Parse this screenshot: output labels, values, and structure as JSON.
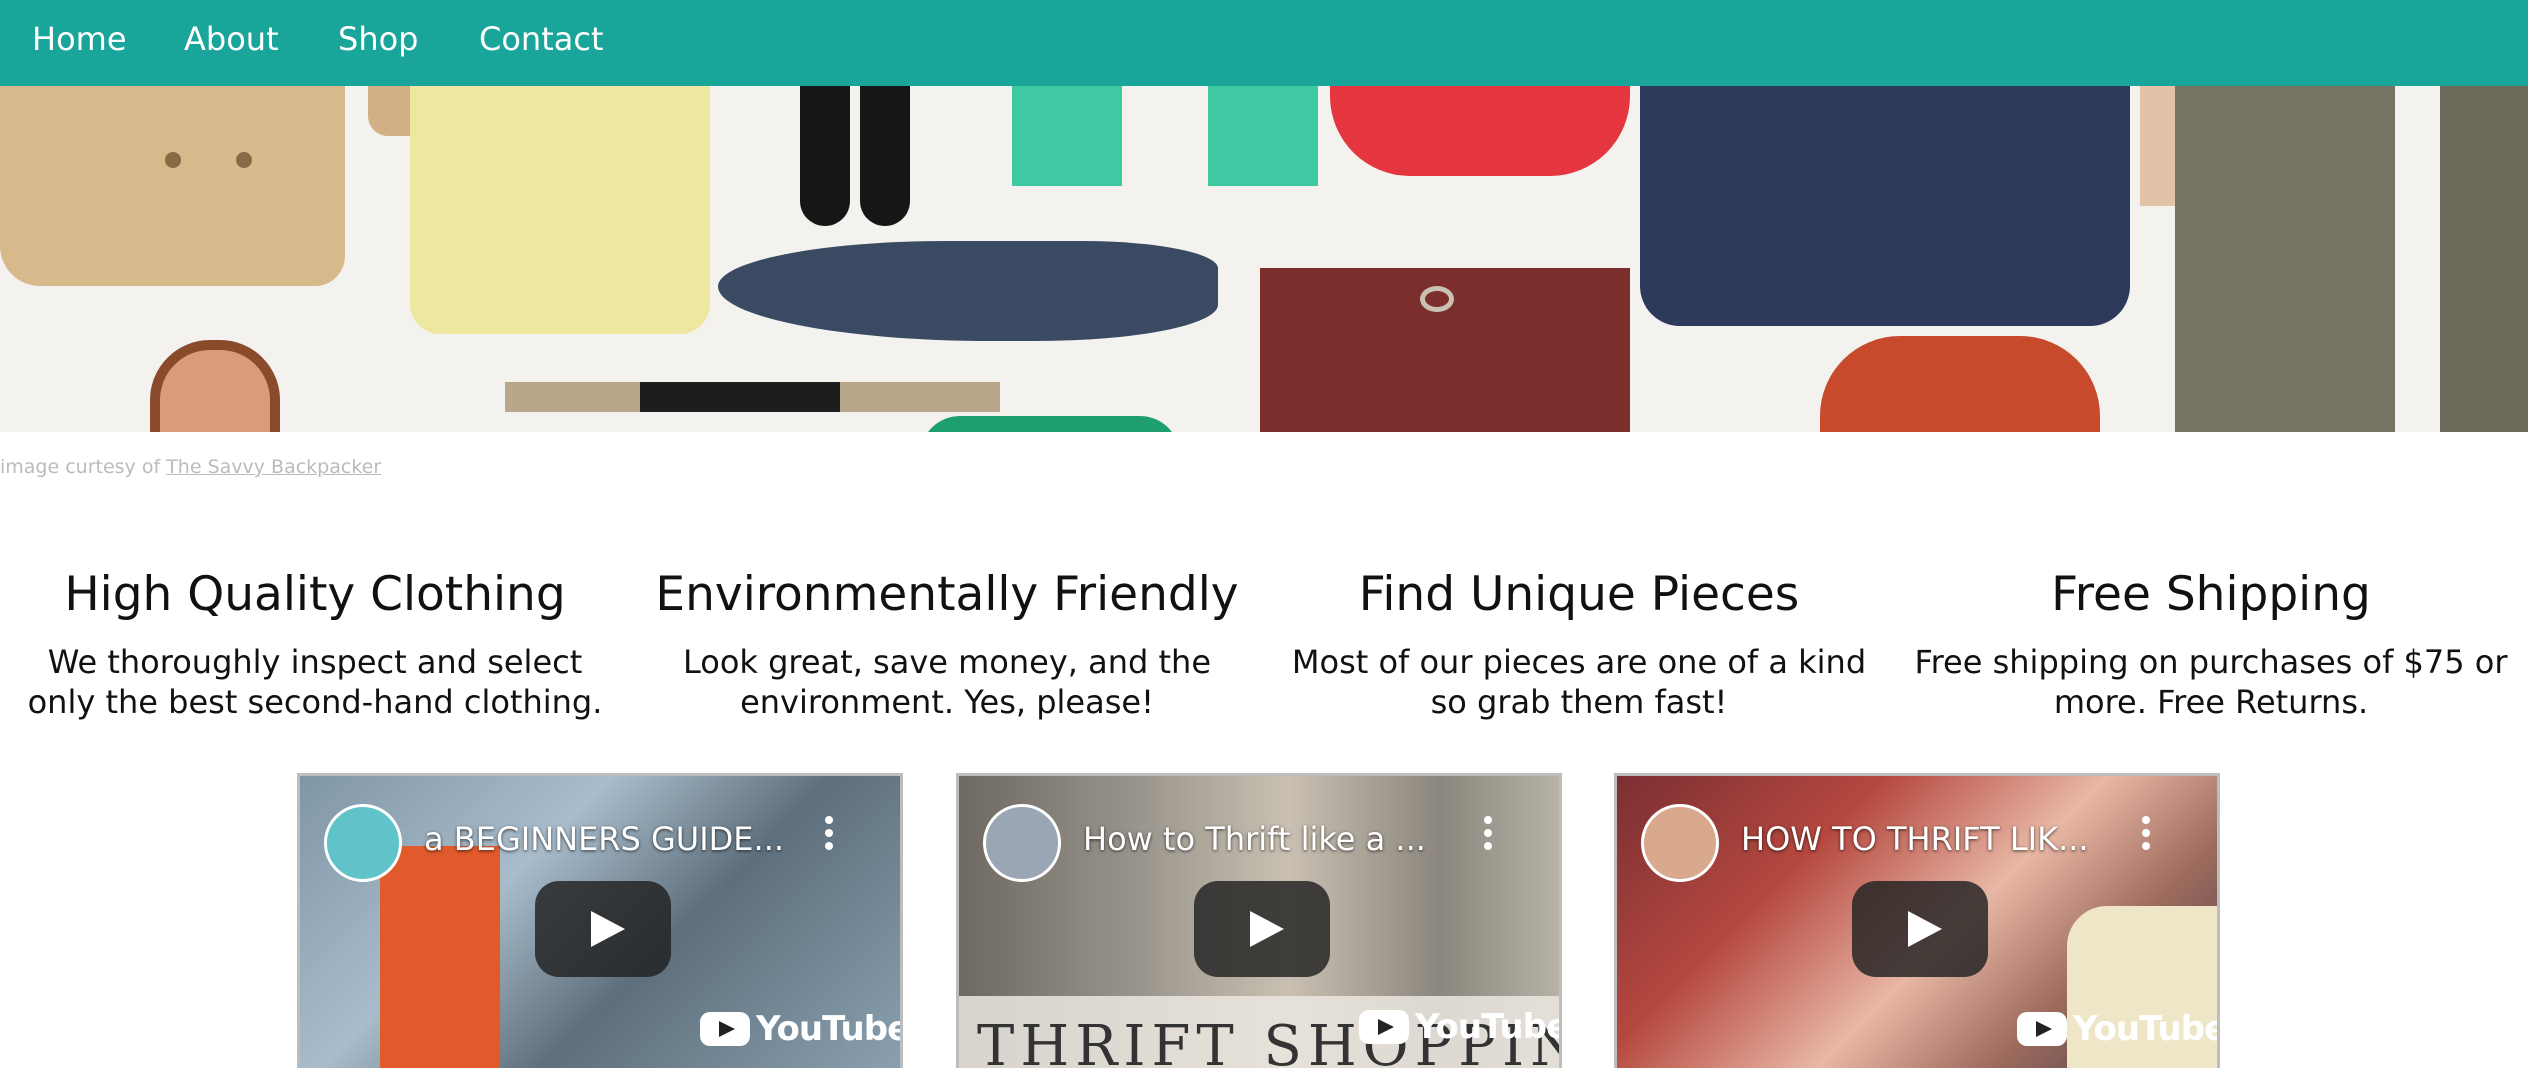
{
  "nav": {
    "items": [
      "Home",
      "About",
      "Shop",
      "Contact"
    ]
  },
  "credit": {
    "prefix": "image curtesy of",
    "link_text": "The Savvy Backpacker"
  },
  "features": [
    {
      "title": "High Quality Clothing",
      "text": "We thoroughly inspect and select only the best second-hand clothing."
    },
    {
      "title": "Environmentally Friendly",
      "text": "Look great, save money, and the environment. Yes, please!"
    },
    {
      "title": "Find Unique Pieces",
      "text": "Most of our pieces are one of a kind so grab them fast!"
    },
    {
      "title": "Free Shipping",
      "text": "Free shipping on purchases of $75 or more. Free Returns."
    }
  ],
  "videos": [
    {
      "title": "a BEGINNERS GUIDE...",
      "logo_text": "YouTube"
    },
    {
      "title": "How to Thrift like a ...",
      "logo_text": "YouTube",
      "overlay_text": "THRIFT SHOPPING"
    },
    {
      "title": "HOW TO THRIFT LIK...",
      "logo_text": "YouTube"
    }
  ],
  "colors": {
    "nav_bg": "#1aa59b",
    "credit_text": "#b9bcbd"
  }
}
